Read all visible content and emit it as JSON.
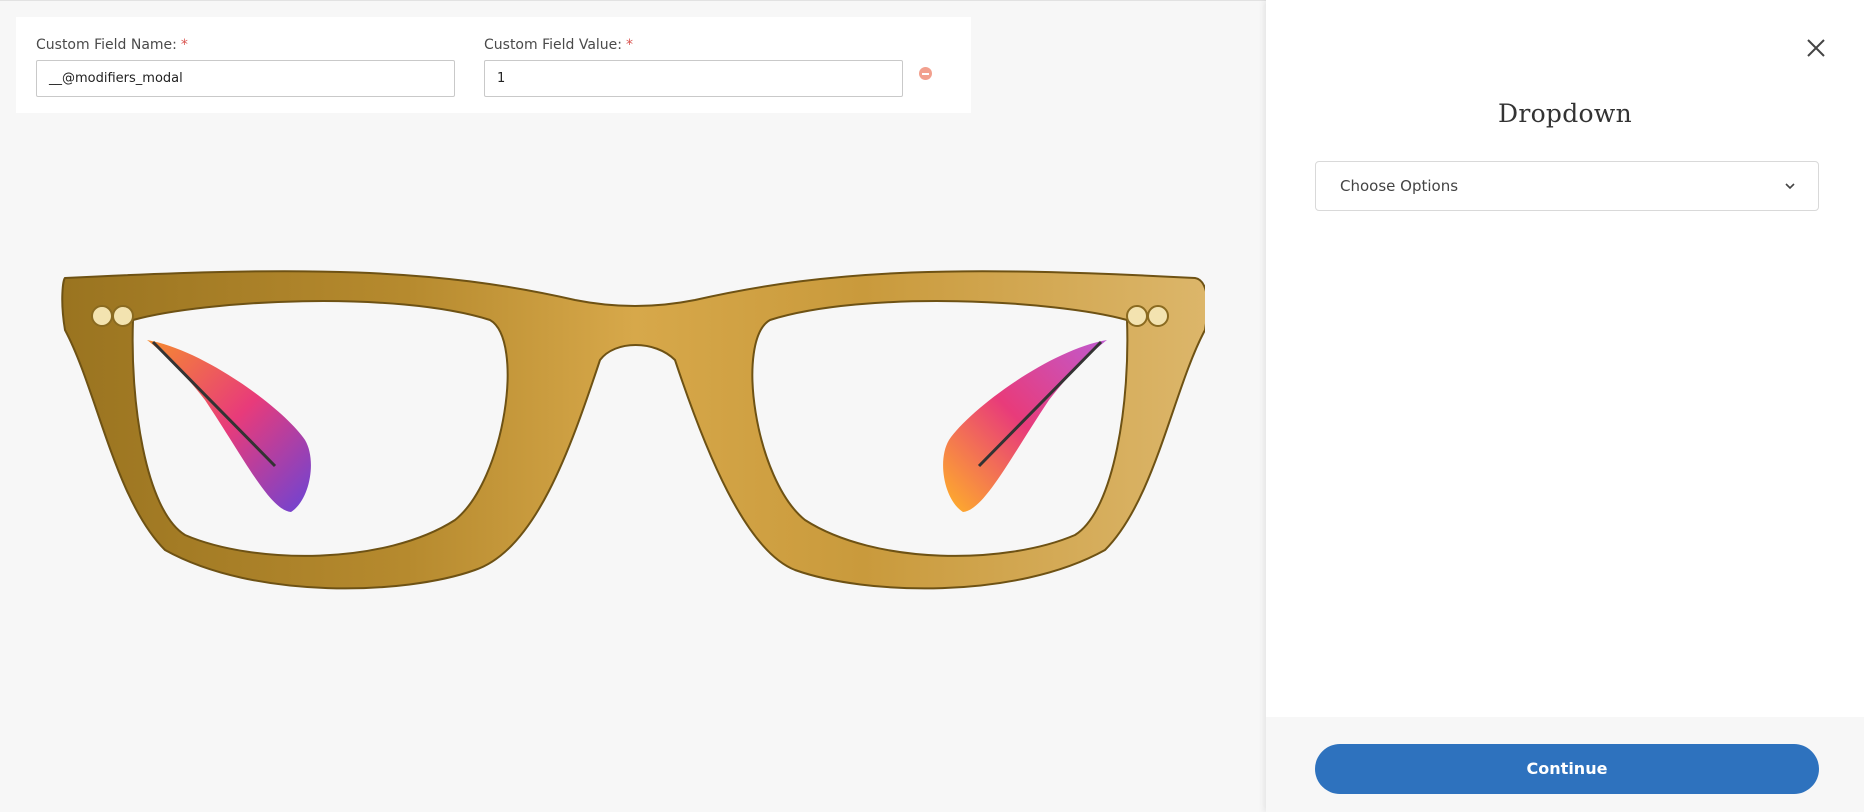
{
  "custom_fields": {
    "name_label": "Custom Field Name:",
    "value_label": "Custom Field Value:",
    "required_marker": "*",
    "name_value": "__@modifiers_modal",
    "value_value": "1"
  },
  "product": {
    "image": "eyeglasses-frame",
    "frame_color": "#b8892c",
    "temple_colors": [
      "#f58b2f",
      "#e83b7a",
      "#7a3fd0"
    ]
  },
  "panel": {
    "title": "Dropdown",
    "dropdown": {
      "selected": "Choose Options"
    },
    "continue_label": "Continue",
    "accent_color": "#2e72be"
  }
}
